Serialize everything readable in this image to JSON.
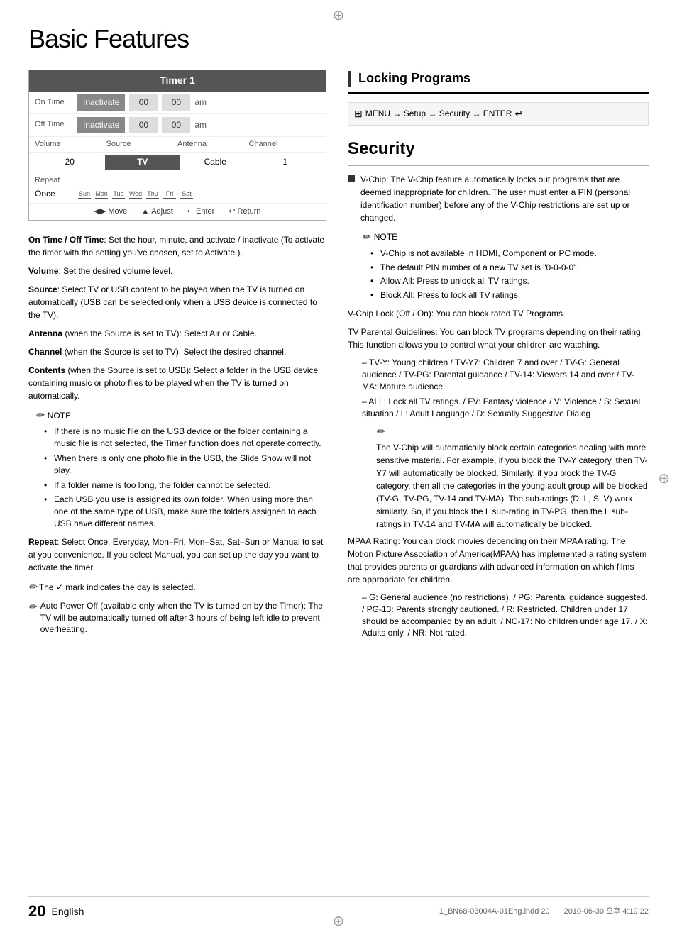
{
  "page": {
    "title": "Basic Features",
    "page_number": "20",
    "language": "English",
    "file_info": "1_BN68-03004A-01Eng.indd   20",
    "date_info": "2010-06-30   오후 4:19:22"
  },
  "timer": {
    "title": "Timer 1",
    "on_time_label": "On Time",
    "on_time_field": "Inactivate",
    "on_time_h": "00",
    "on_time_m": "00",
    "on_time_ampm": "am",
    "off_time_label": "Off Time",
    "off_time_field": "Inactivate",
    "off_time_h": "00",
    "off_time_m": "00",
    "off_time_ampm": "am",
    "vol_label": "Volume",
    "src_label": "Source",
    "ant_label": "Antenna",
    "ch_label": "Channel",
    "vol_value": "20",
    "src_value": "TV",
    "ant_value": "Cable",
    "ch_value": "1",
    "repeat_label": "Repeat",
    "repeat_value": "Once",
    "days": [
      "Sun",
      "Mon",
      "Tue",
      "Wed",
      "Thu",
      "Fri",
      "Sat"
    ],
    "nav_move": "Move",
    "nav_adjust": "Adjust",
    "nav_enter": "Enter",
    "nav_return": "Return"
  },
  "left_content": {
    "para1_bold": "On Time / Off Time",
    "para1_text": ": Set the hour, minute, and activate / inactivate (To activate the timer with the setting you've chosen, set to Activate.).",
    "para2_bold": "Volume",
    "para2_text": ": Set the desired volume level.",
    "para3_bold": "Source",
    "para3_text": ": Select TV or USB content to be played when the TV is turned on automatically (USB can be selected only when a USB device is connected to the TV).",
    "para4_bold": "Antenna",
    "para4_text": " (when the Source is set to TV): Select Air or Cable.",
    "para5_bold": "Channel",
    "para5_text": " (when the Source is set to TV): Select the desired channel.",
    "para6_bold": "Contents",
    "para6_text": " (when the Source is set to USB): Select a folder in the USB device containing music or photo files to be played when the TV is turned on automatically.",
    "note_label": "NOTE",
    "note_items": [
      "If there is no music file on the USB device or the folder containing a music file is not selected, the Timer function does not operate correctly.",
      "When there is only one photo file in the USB, the Slide Show will not play.",
      "If a folder name is too long, the folder cannot be selected.",
      "Each USB you use is assigned its own folder. When using more than one of the same type of USB, make sure the folders assigned to each USB have different names."
    ],
    "para7_bold": "Repeat",
    "para7_text": ": Select Once, Everyday, Mon–Fri, Mon–Sat, Sat–Sun or Manual to set at you convenience. If you select Manual, you can set up the day you want to activate the timer.",
    "checkmark_note": "The ✓ mark indicates the day is selected.",
    "auto_power_note": "Auto Power Off (available only when the TV is turned on by the Timer): The TV will be automatically turned off after 3 hours of being left idle to prevent overheating."
  },
  "locking": {
    "section_title": "Locking Programs",
    "menu_path": "MENU  → Setup → Security → ENTER",
    "security_title": "Security",
    "vchip_bold": "V-Chip",
    "vchip_text": ": The V-Chip feature automatically locks out programs that are deemed inappropriate for children. The user must enter a PIN (personal identification number) before any of the V-Chip restrictions are set up or changed.",
    "note_label": "NOTE",
    "vchip_notes": [
      "V-Chip is not available in HDMI, Component or PC mode.",
      "The default PIN number of a new TV set is \"0-0-0-0\".",
      "Allow All: Press to unlock all TV ratings.",
      "Block All: Press to lock all TV ratings."
    ],
    "vchip_lock_bold": "V-Chip Lock (Off / On)",
    "vchip_lock_text": ": You can block rated TV Programs.",
    "tv_parental_bold": "TV Parental Guidelines",
    "tv_parental_text": ": You can block TV programs depending on their rating. This function allows you to control what your children are watching.",
    "dash_items": [
      "TV-Y: Young children / TV-Y7: Children 7 and over / TV-G: General audience / TV-PG: Parental guidance / TV-14: Viewers 14 and over / TV-MA: Mature audience",
      "ALL: Lock all TV ratings. / FV: Fantasy violence / V: Violence / S: Sexual situation / L: Adult Language / D: Sexually Suggestive Dialog"
    ],
    "vchip_auto_note": "The V-Chip will automatically block certain categories dealing with more sensitive material. For example, if you block the TV-Y category, then TV-Y7 will automatically be blocked. Similarly, if you block the TV-G category, then all the categories in the young adult group will be blocked (TV-G, TV-PG, TV-14 and TV-MA). The sub-ratings (D, L, S, V) work similarly. So, if you block the L sub-rating in TV-PG, then the L sub-ratings in TV-14 and TV-MA will automatically be blocked.",
    "mpaa_bold": "MPAA Rating",
    "mpaa_text": ": You can block movies depending on their MPAA rating. The Motion Picture Association of America(MPAA) has implemented a rating system that provides parents or guardians with advanced information on which films are appropriate for children.",
    "mpaa_dash": "G: General audience (no restrictions). / PG: Parental guidance suggested. / PG-13: Parents strongly cautioned. / R: Restricted. Children under 17 should be accompanied by an adult. / NC-17: No children under age 17. / X: Adults only. / NR: Not rated."
  }
}
